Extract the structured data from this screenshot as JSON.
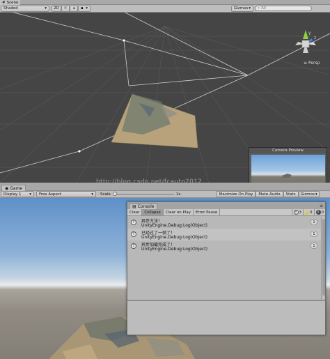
{
  "scene": {
    "tab_label": "Scene",
    "shading_mode": "Shaded",
    "btn_2d": "2D",
    "gizmos_label": "Gizmos",
    "search_placeholder": "All",
    "persp_label": "Persp",
    "camera_preview_title": "Camera Preview",
    "axis_y": "y",
    "axis_z": "z"
  },
  "game": {
    "tab_label": "Game",
    "display": "Display 1",
    "aspect": "Free Aspect",
    "scale_label": "Scale",
    "scale_value": "1x",
    "maximize_on_play": "Maximize On Play",
    "mute_audio": "Mute Audio",
    "stats": "Stats",
    "gizmos": "Gizmos"
  },
  "console": {
    "tab_label": "Console",
    "clear": "Clear",
    "collapse": "Collapse",
    "clear_on_play": "Clear on Play",
    "error_pause": "Error Pause",
    "count_info": "3",
    "count_warning": "0",
    "count_error": "0",
    "entries": [
      {
        "message": "异步方法！",
        "source": "UnityEngine.Debug:Log(Object)",
        "count": "1"
      },
      {
        "message": "已经过了一帧了！",
        "source": "UnityEngine.Debug:Log(Object)",
        "count": "1"
      },
      {
        "message": "异步加载完成了！",
        "source": "UnityEngine.Debug:Log(Object)",
        "count": "1"
      }
    ]
  },
  "watermark": "http://blog.csdn.net/fcauto2012",
  "colors": {
    "scene_bg": "#454545",
    "panel_gray": "#bdbdbd",
    "sky_top": "#5f90c8",
    "ground": "#908b83",
    "terrain": "#b9a37c"
  },
  "icons": [
    "scene-icon",
    "game-icon",
    "console-icon",
    "sun-icon",
    "audio-icon",
    "image-icon",
    "search-icon",
    "info-icon",
    "warning-icon",
    "error-icon",
    "menu-icon"
  ]
}
